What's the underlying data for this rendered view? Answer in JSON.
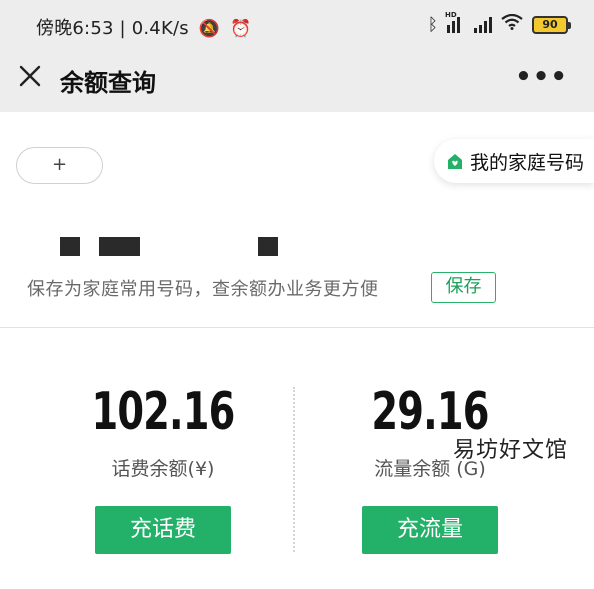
{
  "status_bar": {
    "time": "傍晚6:53",
    "speed": "0.4K/s",
    "net_hd_label": "HD",
    "battery_level": "90"
  },
  "nav": {
    "title": "余额查询",
    "more_label": "•••"
  },
  "number_bar": {
    "add_label": "+",
    "family_label": "我的家庭号码"
  },
  "save_hint": {
    "text": "保存为家庭常用号码，查余额办业务更方便",
    "save_label": "保存"
  },
  "balances": [
    {
      "amount": "102.16",
      "label": "话费余额(¥)",
      "button": "充话费"
    },
    {
      "amount": "29.16",
      "label": "流量余额 (G)",
      "button": "充流量"
    }
  ],
  "colors": {
    "accent": "#23b068",
    "nav_bg": "#ededed"
  },
  "watermark": "易坊好文馆"
}
